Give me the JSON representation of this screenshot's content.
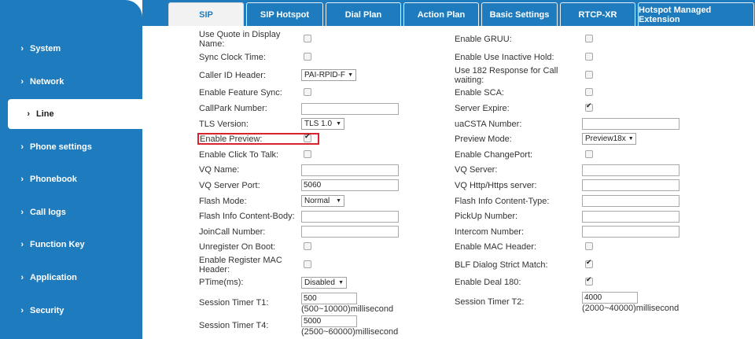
{
  "sidebar": {
    "items": [
      {
        "label": "System"
      },
      {
        "label": "Network"
      },
      {
        "label": "Line"
      },
      {
        "label": "Phone settings"
      },
      {
        "label": "Phonebook"
      },
      {
        "label": "Call logs"
      },
      {
        "label": "Function Key"
      },
      {
        "label": "Application"
      },
      {
        "label": "Security"
      }
    ],
    "chevron": "›"
  },
  "tabs": [
    {
      "label": "SIP"
    },
    {
      "label": "SIP Hotspot"
    },
    {
      "label": "Dial Plan"
    },
    {
      "label": "Action Plan"
    },
    {
      "label": "Basic Settings"
    },
    {
      "label": "RTCP-XR"
    },
    {
      "label": "Hotspot Managed Extension"
    }
  ],
  "left": {
    "use_quote": "Use Quote in Display Name:",
    "sync_clock": "Sync Clock Time:",
    "caller_id_header": "Caller ID Header:",
    "caller_id_value": "PAI-RPID-F",
    "enable_feature_sync": "Enable Feature Sync:",
    "callpark_number": "CallPark Number:",
    "tls_version": "TLS Version:",
    "tls_value": "TLS 1.0",
    "enable_preview": "Enable Preview:",
    "enable_click_to_talk": "Enable Click To Talk:",
    "vq_name": "VQ Name:",
    "vq_server_port": "VQ Server Port:",
    "vq_server_port_value": "5060",
    "flash_mode": "Flash Mode:",
    "flash_mode_value": "Normal",
    "flash_info_body": "Flash Info Content-Body:",
    "joincall_number": "JoinCall Number:",
    "unregister_on_boot": "Unregister On Boot:",
    "enable_register_mac": "Enable Register MAC Header:",
    "ptime": "PTime(ms):",
    "ptime_value": "Disabled",
    "session_timer_t1": "Session Timer T1:",
    "t1_value": "500",
    "t1_hint": "(500~10000)millisecond",
    "session_timer_t4": "Session Timer T4:",
    "t4_value": "5000",
    "t4_hint": "(2500~60000)millisecond"
  },
  "right": {
    "enable_gruu": "Enable GRUU:",
    "enable_inactive_hold": "Enable Use Inactive Hold:",
    "use_182": "Use 182 Response for Call waiting:",
    "enable_sca": "Enable SCA:",
    "server_expire": "Server Expire:",
    "uacsta_number": "uaCSTA Number:",
    "preview_mode": "Preview Mode:",
    "preview_mode_value": "Preview18x",
    "enable_changeport": "Enable ChangePort:",
    "vq_server": "VQ Server:",
    "vq_http_server": "VQ Http/Https server:",
    "flash_info_type": "Flash Info Content-Type:",
    "pickup_number": "PickUp Number:",
    "intercom_number": "Intercom Number:",
    "enable_mac_header": "Enable MAC Header:",
    "blf_dialog_strict": "BLF Dialog Strict Match:",
    "enable_deal_180": "Enable Deal 180:",
    "session_timer_t2": "Session Timer T2:",
    "t2_value": "4000",
    "t2_hint": "(2000~40000)millisecond"
  },
  "dropdown_arrow": "▼",
  "colors": {
    "sidebar": "#1e7bbd",
    "highlight": "#d9232e"
  }
}
